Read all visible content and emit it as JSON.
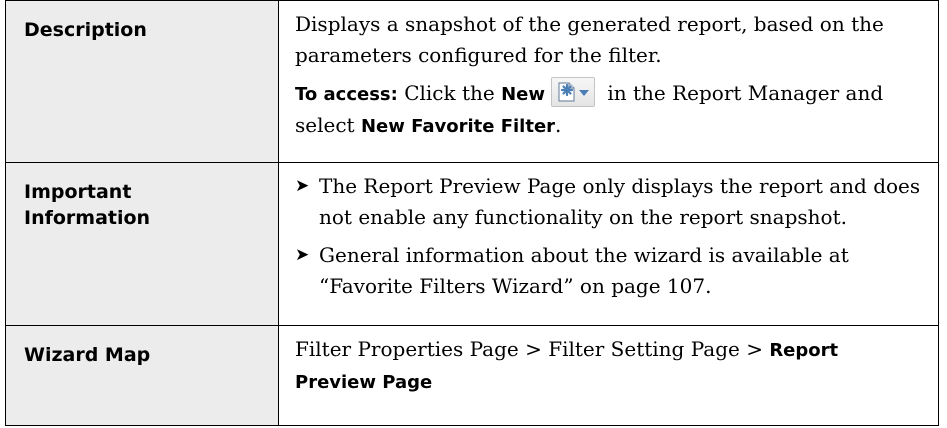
{
  "rows": {
    "description": {
      "header": "Description",
      "text": "Displays a snapshot of the generated report, based on the parameters configured for the filter.",
      "access_label": "To access:",
      "access_pre": " Click the ",
      "access_button": "New",
      "access_mid": " in the Report Manager and select ",
      "access_target": "New Favorite Filter",
      "access_end": "."
    },
    "important": {
      "header": "Important Information",
      "bullets": [
        "The Report Preview Page only displays the report and does not enable any functionality on the report snapshot.",
        "General information about the wizard is available at “Favorite Filters Wizard” on page 107."
      ],
      "bullet_glyph": "➤"
    },
    "wizard_map": {
      "header": "Wizard Map",
      "path_plain": "Filter Properties Page > Filter Setting Page > ",
      "path_current": "Report Preview Page"
    }
  },
  "icons": {
    "new_button_icon": "new-document-star-icon",
    "dropdown_icon": "dropdown-arrow-icon",
    "accent_color": "#4a7fb5"
  }
}
